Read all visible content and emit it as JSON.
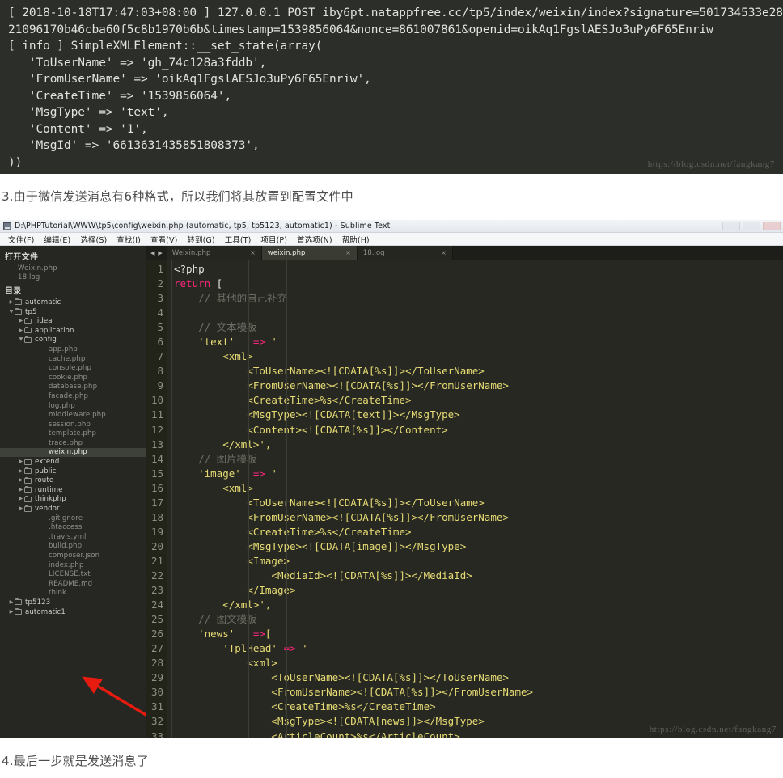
{
  "log_screenshot": {
    "lines": [
      "[ 2018-10-18T17:47:03+08:00 ] 127.0.0.1 POST iby6pt.natappfree.cc/tp5/index/weixin/index?signature=501734533e2821096170b46cba60f5c8b1970b6b&timestamp=1539856064&nonce=861007861&openid=oikAq1FgslAESJo3uPy6F65Enriw",
      "[ info ] SimpleXMLElement::__set_state(array(",
      "   'ToUserName' => 'gh_74c128a3fddb',",
      "   'FromUserName' => 'oikAq1FgslAESJo3uPy6F65Enriw',",
      "   'CreateTime' => '1539856064',",
      "   'MsgType' => 'text',",
      "   'Content' => '1',",
      "   'MsgId' => '6613631435851808373',",
      "))"
    ],
    "watermark": "https://blog.csdn.net/fangkang7"
  },
  "captions": {
    "step3": "3.由于微信发送消息有6种格式，所以我们将其放置到配置文件中",
    "step4": "4.最后一步就是发送消息了"
  },
  "sublime": {
    "title": "D:\\PHPTutorial\\WWW\\tp5\\config\\weixin.php (automatic, tp5, tp5123, automatic1) - Sublime Text",
    "menu": [
      "文件(F)",
      "编辑(E)",
      "选择(S)",
      "查找(I)",
      "查看(V)",
      "转到(G)",
      "工具(T)",
      "项目(P)",
      "首选项(N)",
      "帮助(H)"
    ],
    "sidebar": {
      "open_files_header": "打开文件",
      "open_files": [
        "Weixin.php",
        "18.log"
      ],
      "folders_header": "目录",
      "tree": [
        {
          "label": "automatic",
          "type": "folder",
          "indent": 1,
          "arrow": "collapsed",
          "selected": false
        },
        {
          "label": "tp5",
          "type": "folder",
          "indent": 1,
          "arrow": "expanded",
          "selected": false
        },
        {
          "label": ".idea",
          "type": "folder",
          "indent": 2,
          "arrow": "collapsed",
          "selected": false
        },
        {
          "label": "application",
          "type": "folder",
          "indent": 2,
          "arrow": "collapsed",
          "selected": false
        },
        {
          "label": "config",
          "type": "folder",
          "indent": 2,
          "arrow": "expanded",
          "selected": false
        },
        {
          "label": "app.php",
          "type": "file",
          "indent": 4,
          "arrow": "",
          "selected": false
        },
        {
          "label": "cache.php",
          "type": "file",
          "indent": 4,
          "arrow": "",
          "selected": false
        },
        {
          "label": "console.php",
          "type": "file",
          "indent": 4,
          "arrow": "",
          "selected": false
        },
        {
          "label": "cookie.php",
          "type": "file",
          "indent": 4,
          "arrow": "",
          "selected": false
        },
        {
          "label": "database.php",
          "type": "file",
          "indent": 4,
          "arrow": "",
          "selected": false
        },
        {
          "label": "facade.php",
          "type": "file",
          "indent": 4,
          "arrow": "",
          "selected": false
        },
        {
          "label": "log.php",
          "type": "file",
          "indent": 4,
          "arrow": "",
          "selected": false
        },
        {
          "label": "middleware.php",
          "type": "file",
          "indent": 4,
          "arrow": "",
          "selected": false
        },
        {
          "label": "session.php",
          "type": "file",
          "indent": 4,
          "arrow": "",
          "selected": false
        },
        {
          "label": "template.php",
          "type": "file",
          "indent": 4,
          "arrow": "",
          "selected": false
        },
        {
          "label": "trace.php",
          "type": "file",
          "indent": 4,
          "arrow": "",
          "selected": false
        },
        {
          "label": "weixin.php",
          "type": "file",
          "indent": 4,
          "arrow": "",
          "selected": true
        },
        {
          "label": "extend",
          "type": "folder",
          "indent": 2,
          "arrow": "collapsed",
          "selected": false
        },
        {
          "label": "public",
          "type": "folder",
          "indent": 2,
          "arrow": "collapsed",
          "selected": false
        },
        {
          "label": "route",
          "type": "folder",
          "indent": 2,
          "arrow": "collapsed",
          "selected": false
        },
        {
          "label": "runtime",
          "type": "folder",
          "indent": 2,
          "arrow": "collapsed",
          "selected": false
        },
        {
          "label": "thinkphp",
          "type": "folder",
          "indent": 2,
          "arrow": "collapsed",
          "selected": false
        },
        {
          "label": "vendor",
          "type": "folder",
          "indent": 2,
          "arrow": "collapsed",
          "selected": false
        },
        {
          "label": ".gitignore",
          "type": "file",
          "indent": 4,
          "arrow": "",
          "selected": false
        },
        {
          "label": ".htaccess",
          "type": "file",
          "indent": 4,
          "arrow": "",
          "selected": false
        },
        {
          "label": ".travis.yml",
          "type": "file",
          "indent": 4,
          "arrow": "",
          "selected": false
        },
        {
          "label": "build.php",
          "type": "file",
          "indent": 4,
          "arrow": "",
          "selected": false
        },
        {
          "label": "composer.json",
          "type": "file",
          "indent": 4,
          "arrow": "",
          "selected": false
        },
        {
          "label": "index.php",
          "type": "file",
          "indent": 4,
          "arrow": "",
          "selected": false
        },
        {
          "label": "LICENSE.txt",
          "type": "file",
          "indent": 4,
          "arrow": "",
          "selected": false
        },
        {
          "label": "README.md",
          "type": "file",
          "indent": 4,
          "arrow": "",
          "selected": false
        },
        {
          "label": "think",
          "type": "file",
          "indent": 4,
          "arrow": "",
          "selected": false
        },
        {
          "label": "tp5123",
          "type": "folder",
          "indent": 1,
          "arrow": "collapsed",
          "selected": false
        },
        {
          "label": "automatic1",
          "type": "folder",
          "indent": 1,
          "arrow": "collapsed",
          "selected": false
        }
      ]
    },
    "tabs": [
      {
        "label": "Weixin.php",
        "close": "×",
        "active": false
      },
      {
        "label": "weixin.php",
        "close": "×",
        "active": true
      },
      {
        "label": "18.log",
        "close": "×",
        "active": false
      }
    ],
    "line_numbers": [
      "1",
      "2",
      "3",
      "4",
      "5",
      "6",
      "7",
      "8",
      "9",
      "10",
      "11",
      "12",
      "13",
      "14",
      "15",
      "16",
      "17",
      "18",
      "19",
      "20",
      "21",
      "22",
      "23",
      "24",
      "25",
      "26",
      "27",
      "28",
      "29",
      "30",
      "31",
      "32",
      "33"
    ],
    "code_lines": [
      "<?php",
      "return [",
      "    // 其他的自己补充",
      "",
      "    // 文本模板",
      "    'text'   => '",
      "        <xml>",
      "            <ToUserName><![CDATA[%s]]></ToUserName>",
      "            <FromUserName><![CDATA[%s]]></FromUserName>",
      "            <CreateTime>%s</CreateTime>",
      "            <MsgType><![CDATA[text]]></MsgType>",
      "            <Content><![CDATA[%s]]></Content>",
      "        </xml>',",
      "    // 图片模板",
      "    'image'  => '",
      "        <xml>",
      "            <ToUserName><![CDATA[%s]]></ToUserName>",
      "            <FromUserName><![CDATA[%s]]></FromUserName>",
      "            <CreateTime>%s</CreateTime>",
      "            <MsgType><![CDATA[image]]></MsgType>",
      "            <Image>",
      "                <MediaId><![CDATA[%s]]></MediaId>",
      "            </Image>",
      "        </xml>',",
      "    // 图文模板",
      "    'news'   =>[",
      "        'TplHead' => '",
      "            <xml>",
      "                <ToUserName><![CDATA[%s]]></ToUserName>",
      "                <FromUserName><![CDATA[%s]]></FromUserName>",
      "                <CreateTime>%s</CreateTime>",
      "                <MsgType><![CDATA[news]]></MsgType>",
      "                <ArticleCount>%s</ArticleCount>"
    ],
    "watermark": "https://blog.csdn.net/fangkang7"
  },
  "colors": {
    "log_background": "#2b2e29",
    "editor_background": "#272822",
    "gutter_background": "#222319",
    "sidebar_background": "#262722",
    "keyword": "#f9267a",
    "string": "#e6db74",
    "comment": "#6e7066",
    "selection": "#3e4139",
    "annotation_arrow": "#e81b10"
  }
}
